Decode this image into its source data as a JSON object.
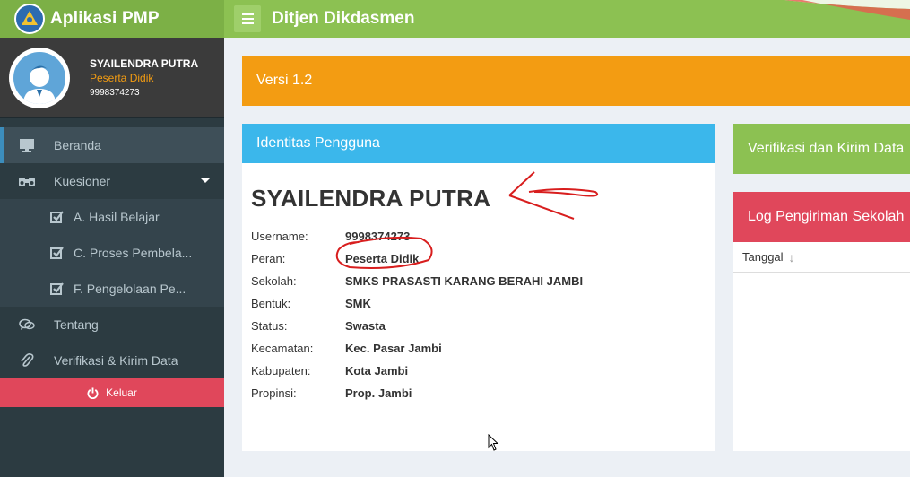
{
  "header": {
    "app_title": "Aplikasi PMP",
    "page_title": "Ditjen Dikdasmen"
  },
  "user_panel": {
    "name": "SYAILENDRA PUTRA",
    "role": "Peserta Didik",
    "id": "9998374273"
  },
  "sidebar": {
    "items": [
      {
        "label": "Beranda",
        "icon": "monitor-icon"
      },
      {
        "label": "Kuesioner",
        "icon": "binoculars-icon"
      },
      {
        "label": "A. Hasil Belajar",
        "icon": "checkbox-icon"
      },
      {
        "label": "C. Proses Pembela...",
        "icon": "checkbox-icon"
      },
      {
        "label": "F. Pengelolaan Pe...",
        "icon": "checkbox-icon"
      },
      {
        "label": "Tentang",
        "icon": "comments-icon"
      },
      {
        "label": "Verifikasi & Kirim Data",
        "icon": "paperclip-icon"
      }
    ],
    "logout_label": "Keluar"
  },
  "main": {
    "version": "Versi 1.2",
    "identity": {
      "title": "Identitas Pengguna",
      "name": "SYAILENDRA PUTRA",
      "fields": [
        {
          "label": "Username:",
          "value": "9998374273"
        },
        {
          "label": "Peran:",
          "value": "Peserta Didik"
        },
        {
          "label": "Sekolah:",
          "value": "SMKS PRASASTI KARANG BERAHI JAMBI"
        },
        {
          "label": "Bentuk:",
          "value": "SMK"
        },
        {
          "label": "Status:",
          "value": "Swasta"
        },
        {
          "label": "Kecamatan:",
          "value": "Kec. Pasar Jambi"
        },
        {
          "label": "Kabupaten:",
          "value": "Kota Jambi"
        },
        {
          "label": "Propinsi:",
          "value": "Prop. Jambi"
        }
      ]
    },
    "verify_box": "Verifikasi dan Kirim Data",
    "log_box": {
      "title": "Log Pengiriman Sekolah",
      "column": "Tanggal"
    }
  },
  "colors": {
    "header_green": "#8cc152",
    "brand_green": "#7cb046",
    "orange": "#f39c12",
    "blue": "#3bb7eb",
    "red": "#e0475b",
    "sidebar_bg": "#2c3b41"
  }
}
